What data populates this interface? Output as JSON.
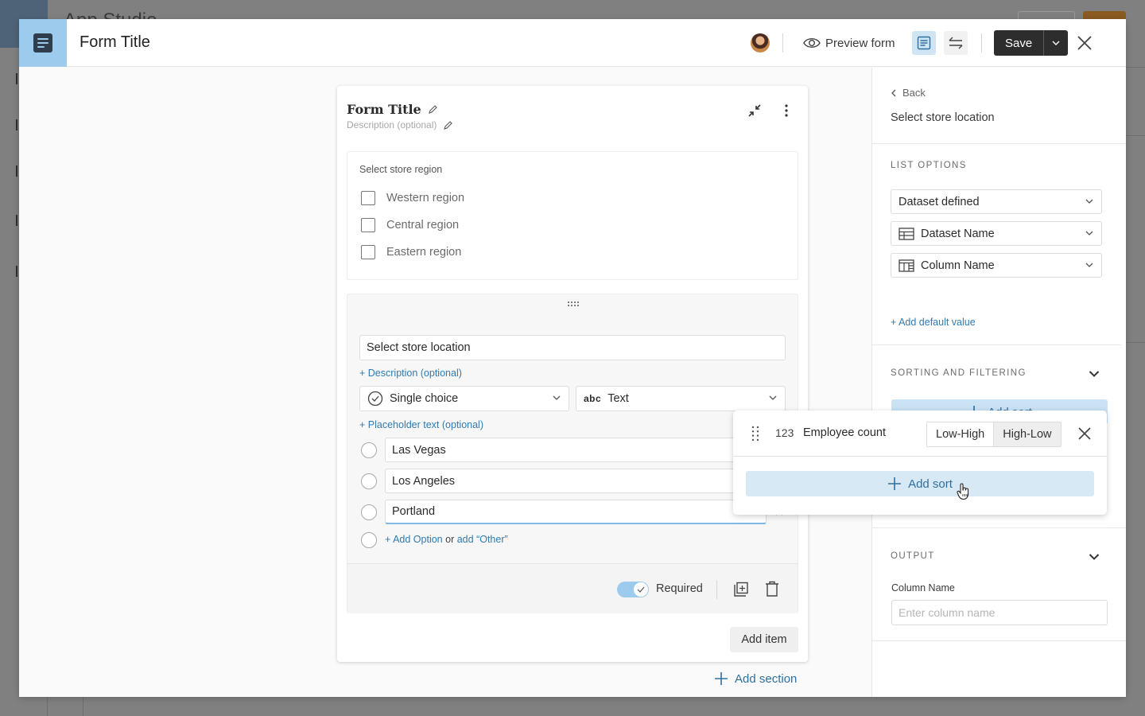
{
  "backdrop": {
    "app_title": "App Studio"
  },
  "header": {
    "title": "Form Title",
    "preview_label": "Preview form",
    "save_label": "Save",
    "accent_color": "#9dcbee"
  },
  "form": {
    "title": "Form Title",
    "description_placeholder": "Description (optional)",
    "question1": {
      "label": "Select store region",
      "options": [
        "Western region",
        "Central region",
        "Eastern region"
      ]
    },
    "question2": {
      "title_value": "Select store location",
      "add_description": "+ Description (optional)",
      "type_select": "Single choice",
      "data_type_icon": "abc",
      "data_type_select": "Text",
      "add_placeholder": "+ Placeholder text (optional)",
      "options": [
        "Las Vegas",
        "Los Angeles",
        "Portland"
      ],
      "add_option": "+ Add Option",
      "or_text": "or",
      "add_other": "add “Other”",
      "required_label": "Required",
      "required_on": true
    },
    "add_item_label": "Add item",
    "add_section_label": "Add section"
  },
  "panel": {
    "back_label": "Back",
    "title": "Select store location",
    "list_options_header": "LIST OPTIONS",
    "source_select": "Dataset defined",
    "dataset_select": "Dataset Name",
    "column_select": "Column Name",
    "add_default_value": "+ Add default value",
    "sorting_header": "SORTING AND FILTERING",
    "add_sort_label": "Add sort",
    "output_header": "OUTPUT",
    "column_name_label": "Column Name",
    "column_name_placeholder": "Enter column name",
    "column_name_value": ""
  },
  "sort_popover": {
    "field_type_icon": "123",
    "field_name": "Employee count",
    "order_options": [
      "Low-High",
      "High-Low"
    ],
    "selected_order": "High-Low",
    "add_sort_label": "Add sort"
  }
}
